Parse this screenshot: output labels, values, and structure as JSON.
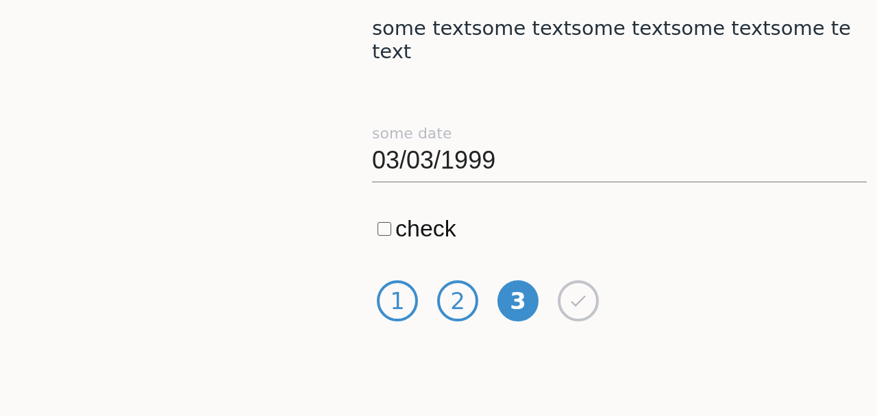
{
  "paragraph": {
    "lines": [
      "some textsome textsome textsome textsome te",
      "text"
    ]
  },
  "date_field": {
    "label": "some date",
    "value": "03/03/1999"
  },
  "checkbox": {
    "label": "check",
    "checked": false
  },
  "steps": [
    {
      "kind": "number",
      "label": "1",
      "selected": false
    },
    {
      "kind": "number",
      "label": "2",
      "selected": false
    },
    {
      "kind": "number",
      "label": "3",
      "selected": true
    },
    {
      "kind": "check",
      "selected": false
    }
  ]
}
